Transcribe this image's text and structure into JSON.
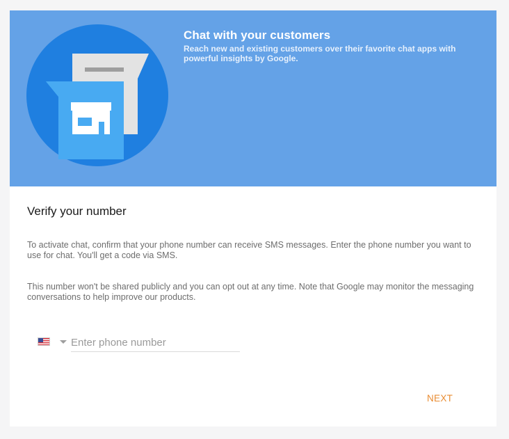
{
  "hero": {
    "title": "Chat with your customers",
    "subtitle": "Reach new and existing customers over their favorite chat apps with powerful insights by Google.",
    "background_color": "#64a2e7",
    "illustration": "storefront-chat-icon"
  },
  "verify": {
    "title": "Verify your number",
    "paragraph_1": "To activate chat, confirm that your phone number can receive SMS messages. Enter the phone number you want to use for chat. You'll get a code via SMS.",
    "paragraph_2": "This number won't be shared publicly and you can opt out at any time. Note that Google may monitor the messaging conversations to help improve our products."
  },
  "phone": {
    "country_flag": "us-flag-icon",
    "placeholder": "Enter phone number",
    "value": ""
  },
  "actions": {
    "next_label": "NEXT",
    "accent_color": "#e98c32"
  }
}
